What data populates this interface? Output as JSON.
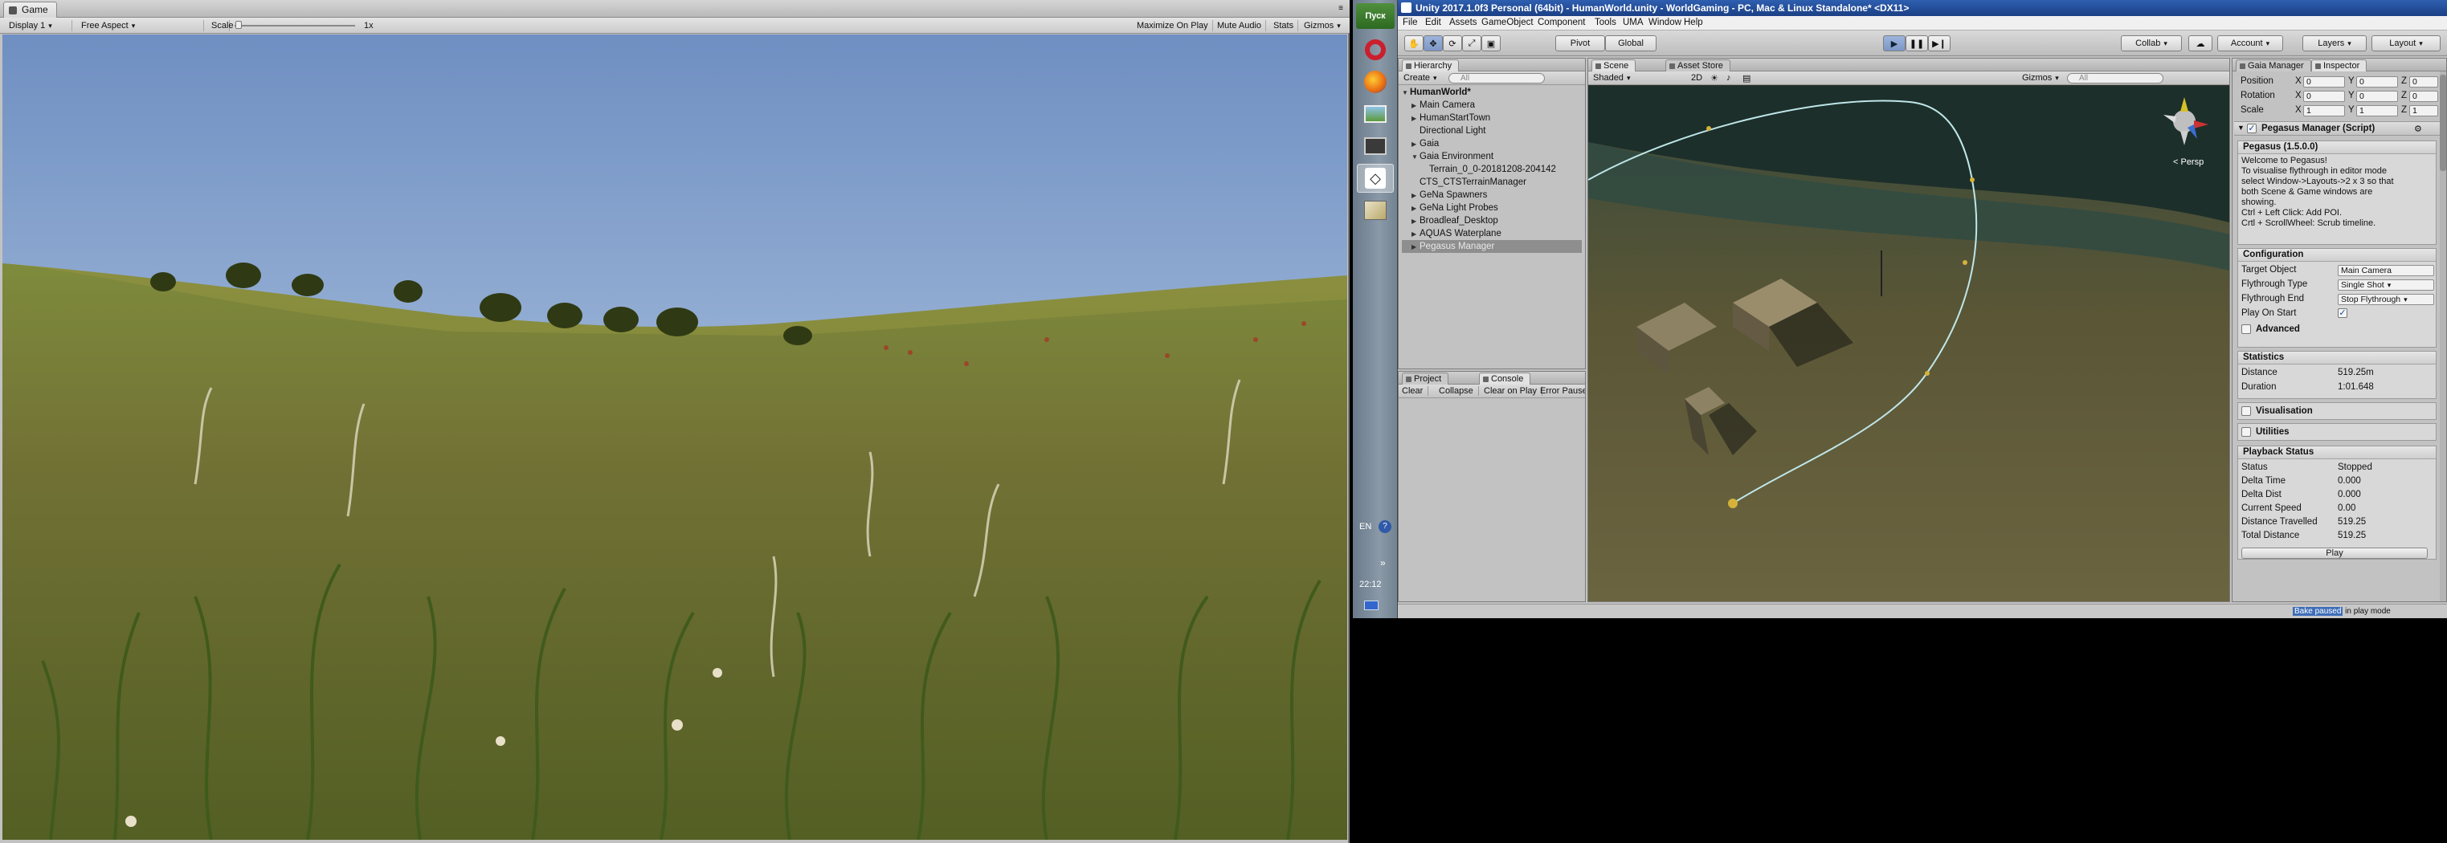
{
  "game": {
    "tab_label": "Game",
    "display": "Display 1",
    "aspect": "Free Aspect",
    "scale_label": "Scale",
    "scale_value": "1x",
    "maximize": "Maximize On Play",
    "mute": "Mute Audio",
    "stats": "Stats",
    "gizmos": "Gizmos"
  },
  "taskbar": {
    "start": "Пуск",
    "lang": "EN",
    "time": "22:12",
    "chevron": "»"
  },
  "unity": {
    "title": "Unity 2017.1.0f3 Personal (64bit) - HumanWorld.unity - WorldGaming - PC, Mac & Linux Standalone* <DX11>",
    "menus": [
      "File",
      "Edit",
      "Assets",
      "GameObject",
      "Component",
      "Tools",
      "UMA",
      "Window",
      "Help"
    ],
    "toolbar": {
      "pivot": "Pivot",
      "global": "Global",
      "collab": "Collab",
      "account": "Account",
      "layers": "Layers",
      "layout": "Layout"
    }
  },
  "hierarchy": {
    "tab": "Hierarchy",
    "create": "Create",
    "search": "All",
    "scene": "HumanWorld*",
    "items": [
      {
        "label": "Main Camera",
        "tri": "▶",
        "indent": 1
      },
      {
        "label": "HumanStartTown",
        "tri": "▶",
        "indent": 1
      },
      {
        "label": "Directional Light",
        "tri": "",
        "indent": 1
      },
      {
        "label": "Gaia",
        "tri": "▶",
        "indent": 1
      },
      {
        "label": "Gaia Environment",
        "tri": "▼",
        "indent": 1
      },
      {
        "label": "Terrain_0_0-20181208-204142",
        "tri": "",
        "indent": 2
      },
      {
        "label": "CTS_CTSTerrainManager",
        "tri": "",
        "indent": 1
      },
      {
        "label": "GeNa Spawners",
        "tri": "▶",
        "indent": 1
      },
      {
        "label": "GeNa Light Probes",
        "tri": "▶",
        "indent": 1
      },
      {
        "label": "Broadleaf_Desktop",
        "tri": "▶",
        "indent": 1
      },
      {
        "label": "AQUAS Waterplane",
        "tri": "▶",
        "indent": 1
      },
      {
        "label": "Pegasus Manager",
        "tri": "▶",
        "indent": 1
      }
    ]
  },
  "console": {
    "tab_project": "Project",
    "tab_console": "Console",
    "buttons": [
      "Clear",
      "Collapse",
      "Clear on Play",
      "Error Pause"
    ]
  },
  "scene": {
    "tab_scene": "Scene",
    "tab_asset": "Asset Store",
    "shading": "Shaded",
    "mode2d": "2D",
    "gizmos": "Gizmos",
    "search": "All",
    "persp": "< Persp"
  },
  "inspector": {
    "tab_gaia": "Gaia Manager",
    "tab_inspector": "Inspector",
    "transform": {
      "position_label": "Position",
      "rotation_label": "Rotation",
      "scale_label": "Scale",
      "position": [
        "0",
        "0",
        "0"
      ],
      "rotation": [
        "0",
        "0",
        "0"
      ],
      "scale": [
        "1",
        "1",
        "1"
      ]
    },
    "component_title": "Pegasus Manager (Script)",
    "version": "Pegasus (1.5.0.0)",
    "welcome": [
      "Welcome to Pegasus!",
      "To visualise flythrough in editor mode",
      "select Window->Layouts->2 x 3 so that",
      "both Scene & Game windows are",
      "showing.",
      "Ctrl + Left Click: Add POI.",
      "Crtl + ScrollWheel: Scrub timeline."
    ],
    "configuration": {
      "header": "Configuration",
      "target_label": "Target Object",
      "target_value": "Main Camera",
      "flytype_label": "Flythrough Type",
      "flytype_value": "Single Shot",
      "flyend_label": "Flythrough End",
      "flyend_value": "Stop Flythrough",
      "playstart_label": "Play On Start",
      "advanced": "Advanced"
    },
    "statistics": {
      "header": "Statistics",
      "distance_label": "Distance",
      "distance_value": "519.25m",
      "duration_label": "Duration",
      "duration_value": "1:01.648"
    },
    "visualisation": "Visualisation",
    "utilities": "Utilities",
    "playback": {
      "header": "Playback Status",
      "rows": [
        {
          "label": "Status",
          "value": "Stopped"
        },
        {
          "label": "Delta Time",
          "value": "0.000"
        },
        {
          "label": "Delta Dist",
          "value": "0.000"
        },
        {
          "label": "Current Speed",
          "value": "0.00"
        },
        {
          "label": "Distance Travelled",
          "value": "519.25"
        },
        {
          "label": "Total Distance",
          "value": "519.25"
        }
      ],
      "play": "Play"
    }
  },
  "status": {
    "bake": "Bake paused",
    "bake_suffix": " in play mode"
  },
  "colors": {
    "accent": "#3d6db8",
    "titlebar": "#1f4690",
    "path": "#bfe6e9"
  }
}
